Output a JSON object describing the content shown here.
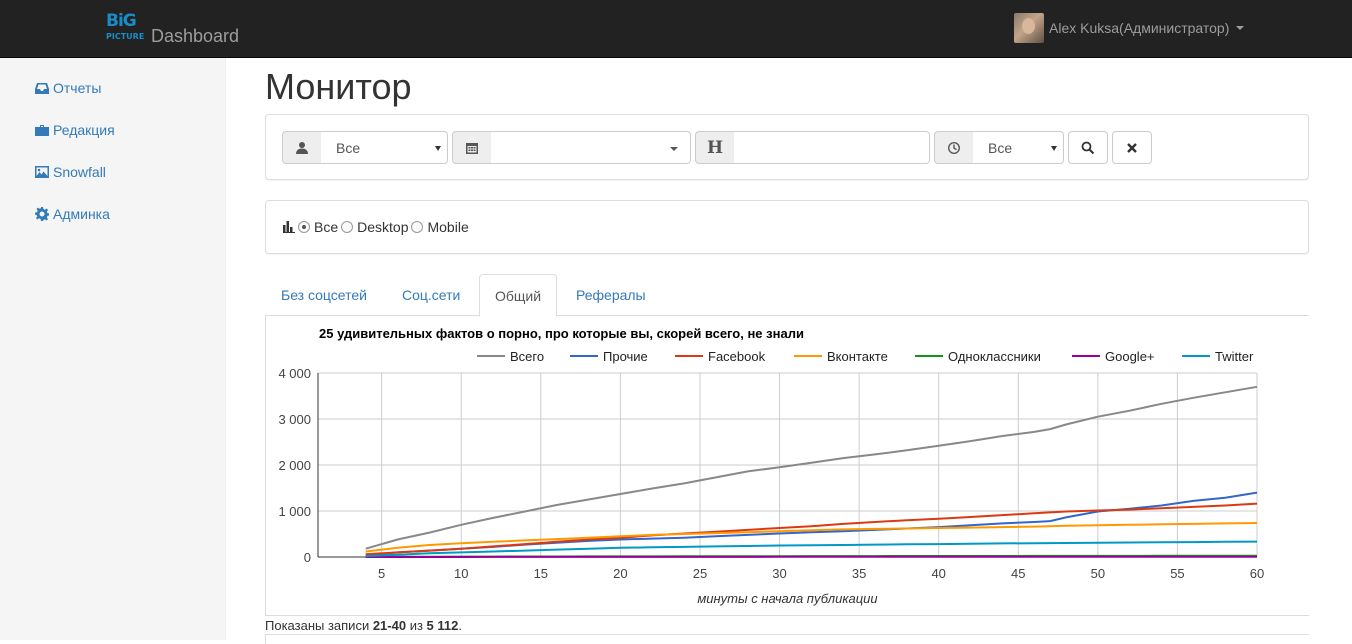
{
  "header": {
    "logo_big": "BiG",
    "logo_picture": "PICTURE",
    "brand": "Dashboard",
    "user": "Alex Kuksa(Администратор)"
  },
  "sidebar": {
    "items": [
      {
        "label": "Отчеты",
        "icon": "inbox-icon"
      },
      {
        "label": "Редакция",
        "icon": "briefcase-icon"
      },
      {
        "label": "Snowfall",
        "icon": "picture-icon"
      },
      {
        "label": "Админка",
        "icon": "gear-icon"
      }
    ]
  },
  "page": {
    "title": "Монитор"
  },
  "filters": {
    "author_value": "Все",
    "date_value": "",
    "header_addon": "H",
    "headline_value": "",
    "time_value": "Все"
  },
  "device": {
    "options": [
      "Все",
      "Desktop",
      "Mobile"
    ],
    "selected": "Все"
  },
  "tabs": {
    "items": [
      "Без соцсетей",
      "Соц.сети",
      "Общий",
      "Рефералы"
    ],
    "active": "Общий"
  },
  "records": {
    "prefix": "Показаны записи ",
    "range": "21-40",
    "middle": " из ",
    "total": "5 112",
    "suffix": "."
  },
  "chart_data": {
    "type": "line",
    "title": "25 удивительных фактов о порно, про которые вы, скорей всего, не знали",
    "xlabel": "минуты с начала публикации",
    "ylabel": "",
    "xlim": [
      1,
      60
    ],
    "ylim": [
      0,
      4000
    ],
    "x_ticks": [
      5,
      10,
      15,
      20,
      25,
      30,
      35,
      40,
      45,
      50,
      55,
      60
    ],
    "y_ticks": [
      0,
      1000,
      2000,
      3000,
      4000
    ],
    "y_tick_labels": [
      "0",
      "1 000",
      "2 000",
      "3 000",
      "4 000"
    ],
    "legend_position": "top",
    "grid": true,
    "x": [
      4,
      6,
      8,
      10,
      12,
      14,
      16,
      18,
      20,
      22,
      24,
      26,
      28,
      30,
      32,
      34,
      36,
      38,
      40,
      42,
      44,
      46,
      47,
      48,
      50,
      52,
      54,
      56,
      58,
      60
    ],
    "series": [
      {
        "name": "Всего",
        "color": "#888888",
        "values": [
          180,
          380,
          530,
          700,
          850,
          990,
          1130,
          1250,
          1370,
          1490,
          1600,
          1730,
          1860,
          1950,
          2050,
          2150,
          2230,
          2320,
          2420,
          2520,
          2630,
          2720,
          2780,
          2880,
          3050,
          3180,
          3330,
          3460,
          3580,
          3700
        ]
      },
      {
        "name": "Прочие",
        "color": "#3366cc",
        "values": [
          40,
          100,
          140,
          180,
          220,
          270,
          310,
          350,
          380,
          400,
          420,
          450,
          480,
          510,
          540,
          560,
          590,
          620,
          650,
          690,
          730,
          760,
          780,
          860,
          990,
          1050,
          1120,
          1220,
          1290,
          1400
        ]
      },
      {
        "name": "Facebook",
        "color": "#dc3912",
        "values": [
          60,
          100,
          140,
          180,
          230,
          280,
          330,
          380,
          420,
          470,
          510,
          550,
          590,
          630,
          670,
          720,
          760,
          800,
          830,
          870,
          910,
          950,
          970,
          990,
          1010,
          1030,
          1060,
          1090,
          1120,
          1160
        ]
      },
      {
        "name": "Вконтакте",
        "color": "#ff9900",
        "values": [
          120,
          200,
          260,
          300,
          330,
          360,
          390,
          420,
          450,
          480,
          500,
          520,
          540,
          560,
          580,
          600,
          610,
          620,
          630,
          640,
          650,
          660,
          670,
          680,
          690,
          700,
          710,
          720,
          730,
          740
        ]
      },
      {
        "name": "Одноклассники",
        "color": "#109618",
        "values": [
          5,
          6,
          7,
          8,
          9,
          10,
          11,
          12,
          13,
          14,
          15,
          16,
          17,
          18,
          19,
          20,
          20,
          21,
          21,
          22,
          22,
          23,
          23,
          23,
          24,
          24,
          25,
          25,
          26,
          26
        ]
      },
      {
        "name": "Google+",
        "color": "#990099",
        "values": [
          0,
          1,
          1,
          1,
          2,
          2,
          2,
          2,
          3,
          3,
          3,
          3,
          3,
          4,
          4,
          4,
          4,
          4,
          5,
          5,
          5,
          5,
          5,
          5,
          6,
          6,
          6,
          6,
          6,
          6
        ]
      },
      {
        "name": "Twitter",
        "color": "#0099c6",
        "values": [
          20,
          50,
          80,
          100,
          120,
          140,
          160,
          180,
          200,
          210,
          220,
          230,
          240,
          250,
          255,
          260,
          270,
          275,
          280,
          290,
          295,
          300,
          302,
          305,
          310,
          315,
          320,
          325,
          330,
          335
        ]
      }
    ]
  }
}
